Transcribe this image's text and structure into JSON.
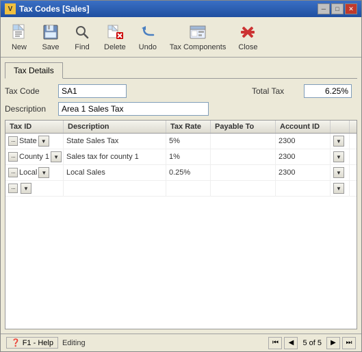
{
  "window": {
    "title": "Tax Codes [Sales]",
    "title_icon": "V"
  },
  "title_buttons": {
    "minimize": "─",
    "maximize": "□",
    "close": "✕"
  },
  "toolbar": {
    "buttons": [
      {
        "label": "New",
        "icon": "new-icon"
      },
      {
        "label": "Save",
        "icon": "save-icon"
      },
      {
        "label": "Find",
        "icon": "find-icon"
      },
      {
        "label": "Delete",
        "icon": "delete-icon"
      },
      {
        "label": "Undo",
        "icon": "undo-icon"
      },
      {
        "label": "Tax Components",
        "icon": "tax-components-icon"
      },
      {
        "label": "Close",
        "icon": "close-icon"
      }
    ]
  },
  "tabs": [
    {
      "label": "Tax Details",
      "active": true
    }
  ],
  "form": {
    "tax_code_label": "Tax Code",
    "tax_code_value": "SA1",
    "total_tax_label": "Total Tax",
    "total_tax_value": "6.25%",
    "description_label": "Description",
    "description_value": "Area 1 Sales Tax"
  },
  "grid": {
    "columns": [
      {
        "label": "Tax ID",
        "key": "tax_id"
      },
      {
        "label": "Description",
        "key": "description"
      },
      {
        "label": "Tax Rate",
        "key": "tax_rate"
      },
      {
        "label": "Payable To",
        "key": "payable_to"
      },
      {
        "label": "Account ID",
        "key": "account_id"
      }
    ],
    "rows": [
      {
        "tax_id": "State",
        "description": "State Sales Tax",
        "tax_rate": "5%",
        "payable_to": "",
        "account_id": "2300"
      },
      {
        "tax_id": "County 1",
        "description": "Sales tax for county 1",
        "tax_rate": "1%",
        "payable_to": "",
        "account_id": "2300"
      },
      {
        "tax_id": "Local",
        "description": "Local Sales",
        "tax_rate": "0.25%",
        "payable_to": "",
        "account_id": "2300"
      },
      {
        "tax_id": "",
        "description": "",
        "tax_rate": "",
        "payable_to": "",
        "account_id": ""
      }
    ]
  },
  "status_bar": {
    "help_label": "F1 - Help",
    "status_text": "Editing",
    "nav_first": "⏮",
    "nav_prev": "◀",
    "nav_current": "5",
    "nav_of": "of",
    "nav_total": "5",
    "nav_next": "▶",
    "nav_last": "⏭"
  }
}
